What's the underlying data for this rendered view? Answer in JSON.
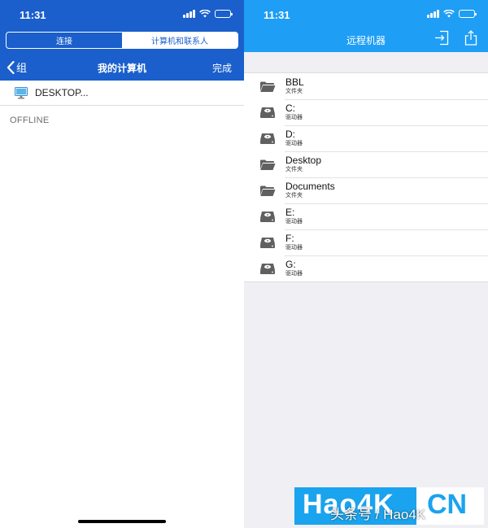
{
  "left": {
    "status": {
      "time": "11:31"
    },
    "segmented": {
      "tab1": "连接",
      "tab2": "计算机和联系人",
      "selected": "计算机和联系人"
    },
    "nav": {
      "back_label": "组",
      "title": "我的计算机",
      "done_label": "完成"
    },
    "devices": [
      {
        "name": "DESKTOP..."
      }
    ],
    "section_label": "OFFLINE"
  },
  "right": {
    "status": {
      "time": "11:31"
    },
    "nav": {
      "title": "远程机器"
    },
    "items": [
      {
        "name": "BBL",
        "type": "文件夹",
        "icon": "folder-icon"
      },
      {
        "name": "C:",
        "type": "驱动器",
        "icon": "drive-icon"
      },
      {
        "name": "D:",
        "type": "驱动器",
        "icon": "drive-icon"
      },
      {
        "name": "Desktop",
        "type": "文件夹",
        "icon": "folder-icon"
      },
      {
        "name": "Documents",
        "type": "文件夹",
        "icon": "folder-icon"
      },
      {
        "name": "E:",
        "type": "驱动器",
        "icon": "drive-icon"
      },
      {
        "name": "F:",
        "type": "驱动器",
        "icon": "drive-icon"
      },
      {
        "name": "G:",
        "type": "驱动器",
        "icon": "drive-icon"
      }
    ]
  },
  "watermark": {
    "logo": "Hao4K",
    "logo_suffix": "CN",
    "overlay": "头条号 / Hao4K"
  },
  "colors": {
    "left_header": "#1a5fcc",
    "right_header": "#1e9ef5",
    "list_bg": "#efeff4",
    "icon_gray": "#606060"
  }
}
